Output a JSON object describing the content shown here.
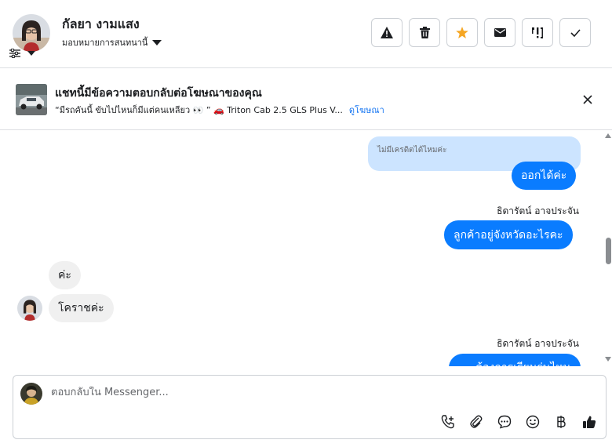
{
  "header": {
    "contact_name": "กัลยา งามแสง",
    "assign_label": "มอบหมายการสนทนานี้",
    "actions": [
      {
        "name": "report-button",
        "icon": "warning-icon"
      },
      {
        "name": "delete-button",
        "icon": "trash-icon"
      },
      {
        "name": "star-button",
        "icon": "star-icon",
        "color": "#f5a623"
      },
      {
        "name": "mark-unread-button",
        "icon": "envelope-icon"
      },
      {
        "name": "follow-up-button",
        "icon": "follow-up-icon"
      },
      {
        "name": "mark-done-button",
        "icon": "check-icon"
      }
    ]
  },
  "ad": {
    "title": "แชทนี้มีข้อความตอบกลับต่อโฆษณาของคุณ",
    "subtitle": "“มีรถคันนี้ ขับไปไหนก็มีแต่คนเหลียว 👀 ” 🚗 Triton Cab 2.5 GLS Plus V...",
    "link": "ดูโฆษณา"
  },
  "thread": {
    "reply_preview": "ไม่มีเครดิตได้ไหมค่ะ",
    "messages": [
      {
        "text": "ออกได้ค่ะ",
        "direction": "out"
      },
      {
        "sender": "ธิดารัตน์ อาจประจัน"
      },
      {
        "text": "ลูกค้าอยู่จังหวัดอะไรคะ",
        "direction": "out"
      },
      {
        "text": "ค่ะ",
        "direction": "in"
      },
      {
        "text": "โคราชค่ะ",
        "direction": "in"
      },
      {
        "sender": "ธิดารัตน์ อาจประจัน"
      },
      {
        "text": "ต้องการเรียนรุ่นไหน",
        "direction": "out"
      }
    ]
  },
  "composer": {
    "placeholder": "ตอบกลับใน Messenger...",
    "tools": [
      "phone-add-icon",
      "paperclip-icon",
      "saved-reply-icon",
      "emoji-icon",
      "baht-icon",
      "thumbs-up-icon"
    ]
  },
  "colors": {
    "accent": "#0a7cff",
    "star": "#f5a623",
    "reply_preview_bg": "#cce4ff",
    "incoming_bg": "#f0f0f0"
  }
}
